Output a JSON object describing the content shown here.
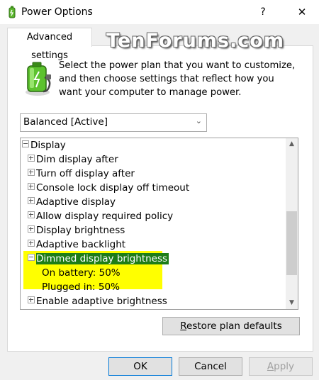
{
  "window": {
    "title": "Power Options",
    "help_label": "?",
    "close_label": "✕"
  },
  "tab": {
    "label": "Advanced settings"
  },
  "watermark": "TenForums.com",
  "intro_text": "Select the power plan that you want to customize, and then choose settings that reflect how you want your computer to manage power.",
  "plan_select": {
    "value": "Balanced [Active]"
  },
  "tree": {
    "root": "Display",
    "items": [
      "Dim display after",
      "Turn off display after",
      "Console lock display off timeout",
      "Adaptive display",
      "Allow display required policy",
      "Display brightness",
      "Adaptive backlight"
    ],
    "selected": {
      "label": "Dimmed display brightness",
      "on_battery_label": "On battery:",
      "on_battery_value": "50%",
      "plugged_in_label": "Plugged in:",
      "plugged_in_value": "50%"
    },
    "after_item": "Enable adaptive brightness"
  },
  "buttons": {
    "restore_pre": "",
    "restore_hot": "R",
    "restore_post": "estore plan defaults",
    "ok": "OK",
    "cancel": "Cancel",
    "apply_hot": "A",
    "apply_post": "pply"
  },
  "colors": {
    "highlight": "#ffff00",
    "selected": "#1e7d18",
    "ok_border": "#0078d7"
  }
}
